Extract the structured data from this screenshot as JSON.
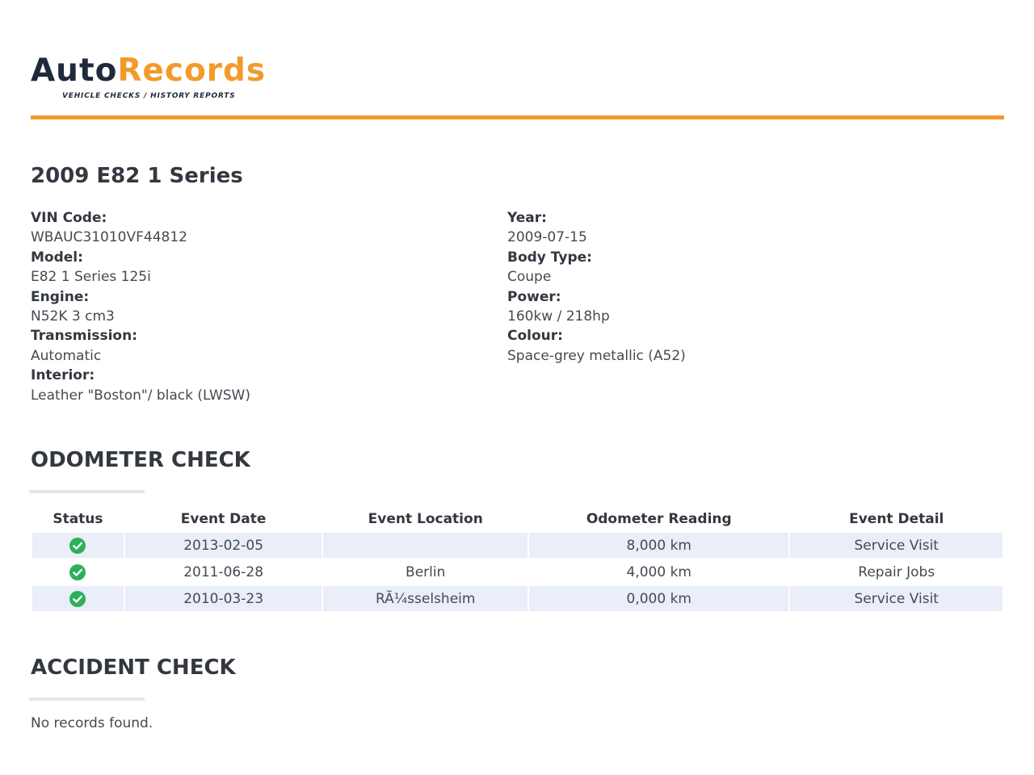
{
  "brand": {
    "name_part1": "Auto",
    "name_part2": "Records",
    "tagline": "VEHICLE CHECKS / HISTORY REPORTS",
    "colors": {
      "dark": "#1f2a3c",
      "accent": "#f39a2b"
    }
  },
  "vehicle": {
    "title": "2009 E82 1 Series",
    "specs_left": [
      {
        "label": "VIN Code:",
        "value": "WBAUC31010VF44812"
      },
      {
        "label": "Model:",
        "value": "E82 1 Series 125i"
      },
      {
        "label": "Engine:",
        "value": "N52K 3 cm3"
      },
      {
        "label": "Transmission:",
        "value": "Automatic"
      },
      {
        "label": "Interior:",
        "value": "Leather \"Boston\"/ black (LWSW)"
      }
    ],
    "specs_right": [
      {
        "label": "Year:",
        "value": "2009-07-15"
      },
      {
        "label": "Body Type:",
        "value": "Coupe"
      },
      {
        "label": "Power:",
        "value": "160kw / 218hp"
      },
      {
        "label": "Colour:",
        "value": "Space-grey metallic (A52)"
      }
    ]
  },
  "odometer": {
    "title": "ODOMETER CHECK",
    "headers": [
      "Status",
      "Event Date",
      "Event Location",
      "Odometer Reading",
      "Event Detail"
    ],
    "rows": [
      {
        "status_icon": "check-circle-icon",
        "date": "2013-02-05",
        "location": "",
        "reading": "8,000 km",
        "detail": "Service Visit"
      },
      {
        "status_icon": "check-circle-icon",
        "date": "2011-06-28",
        "location": "Berlin",
        "reading": "4,000 km",
        "detail": "Repair Jobs"
      },
      {
        "status_icon": "check-circle-icon",
        "date": "2010-03-23",
        "location": "RÃ¼sselsheim",
        "reading": "0,000 km",
        "detail": "Service Visit"
      }
    ],
    "status_color": "#2eb05a",
    "row_shade_color": "#e9eef9"
  },
  "accident": {
    "title": "ACCIDENT CHECK",
    "message": "No records found."
  }
}
